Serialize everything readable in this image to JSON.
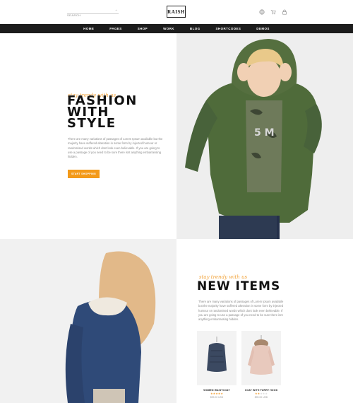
{
  "header": {
    "search_placeholder": "SEARCH",
    "logo": "RAISH"
  },
  "nav": [
    "HOME",
    "PAGES",
    "SHOP",
    "WORK",
    "BLOG",
    "SHORTCODES",
    "DEMOS"
  ],
  "hero": {
    "script": "stay trendy with us",
    "title_lines": [
      "FASHION",
      "WITH",
      "STYLE"
    ],
    "description": "There are many variations of passages of Lorem Ipsum available but the majority have suffered alteration in some form by injected humour or randomised words which dont look even believable. If you are going to use a passage of you need to be sure there isnt anything embarrassing hidden.",
    "button": "START SHOPPING"
  },
  "new_items": {
    "script": "stay trendy with us",
    "title": "NEW ITEMS",
    "description": "There are many variations of passages of Lorem Ipsum available but the majority have suffered alteration in some form by injected humour or randomised words which dont look even believable. If you are going to use a passage of you need to be sure there isnt anything embarrassing hidden.",
    "products": [
      {
        "name": "WOMEN WAISTCOAT",
        "rating": 5,
        "price": "$99.00 USD"
      },
      {
        "name": "COAT WITH FURRY HOOD",
        "rating": 2,
        "price": "$99.00 USD"
      }
    ]
  },
  "colors": {
    "accent": "#f39a1a",
    "nav_bg": "#1c1c1c",
    "text_dark": "#111111"
  }
}
